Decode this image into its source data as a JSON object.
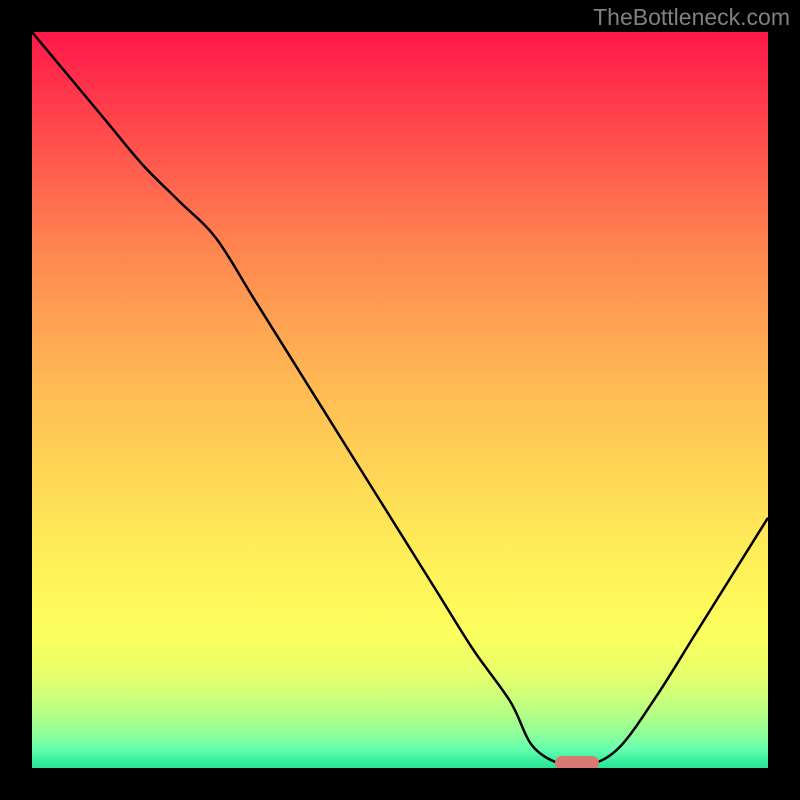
{
  "watermark": "TheBottleneck.com",
  "chart_data": {
    "type": "line",
    "title": "",
    "xlabel": "",
    "ylabel": "",
    "x": [
      0,
      5,
      10,
      15,
      20,
      25,
      30,
      35,
      40,
      45,
      50,
      55,
      60,
      65,
      68,
      72,
      76,
      80,
      85,
      90,
      95,
      100
    ],
    "y": [
      100,
      94,
      88,
      82,
      77,
      72,
      64,
      56,
      48,
      40,
      32,
      24,
      16,
      9,
      3,
      0.5,
      0.5,
      3,
      10,
      18,
      26,
      34
    ],
    "xlim": [
      0,
      100
    ],
    "ylim": [
      0,
      100
    ],
    "minimum_marker_x": 74,
    "annotations": []
  }
}
